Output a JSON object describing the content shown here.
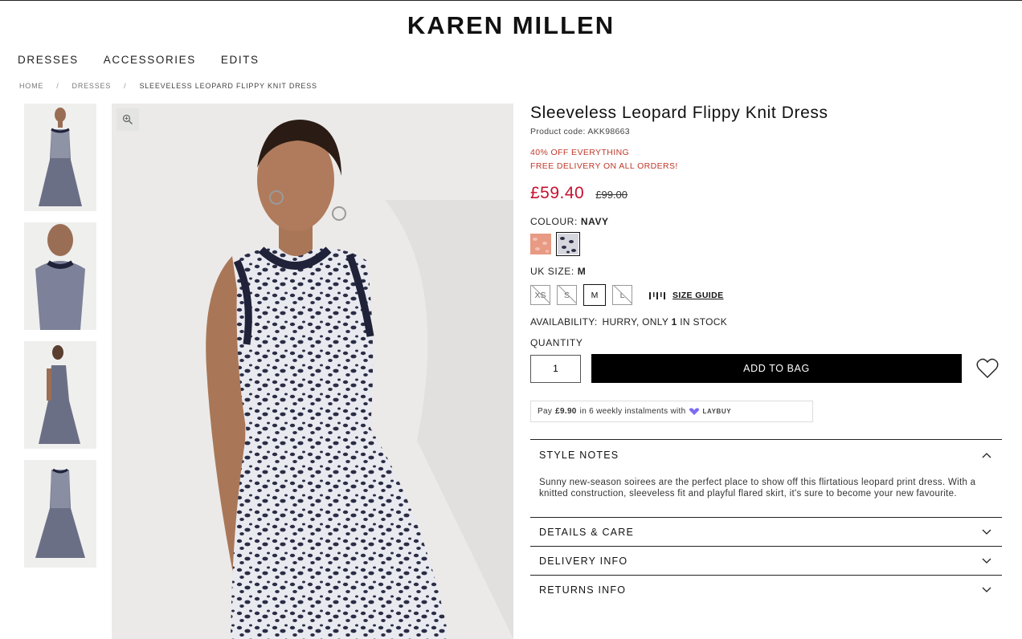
{
  "brand": {
    "name": "KAREN MILLEN"
  },
  "nav": {
    "items": [
      "DRESSES",
      "ACCESSORIES",
      "EDITS"
    ]
  },
  "breadcrumb": {
    "home": "HOME",
    "category": "DRESSES",
    "current": "SLEEVELESS LEOPARD FLIPPY KNIT DRESS",
    "separator": "/"
  },
  "product": {
    "title": "Sleeveless Leopard Flippy Knit Dress",
    "code": "Product code: AKK98663",
    "promo_1": "40% OFF EVERYTHING",
    "promo_2": "FREE DELIVERY ON ALL ORDERS!",
    "price_now": "£59.40",
    "price_was": "£99.00",
    "colour_label": "COLOUR:",
    "colour_value": "NAVY",
    "size_label": "UK SIZE:",
    "size_value": "M",
    "sizes": [
      "XS",
      "S",
      "M",
      "L"
    ],
    "size_guide": "SIZE GUIDE",
    "availability_label": "AVAILABILITY:",
    "availability_pre": "HURRY, ONLY",
    "availability_count": "1",
    "availability_post": "IN STOCK",
    "quantity_label": "QUANTITY",
    "quantity_value": "1",
    "add_to_bag": "ADD TO BAG",
    "colours": {
      "coral": "#e89a84",
      "navy": "#2c2f45"
    }
  },
  "laybuy": {
    "pay": "Pay",
    "amount": "£9.90",
    "rest": "in 6 weekly instalments with",
    "brand": "LAYBUY"
  },
  "accordion": {
    "style_notes": "STYLE NOTES",
    "style_notes_body": "Sunny new-season soirees are the perfect place to show off this flirtatious leopard print dress. With a knitted construction, sleeveless fit and playful flared skirt, it's sure to become your new favourite.",
    "details_care": "DETAILS & CARE",
    "delivery_info": "DELIVERY INFO",
    "returns_info": "RETURNS INFO"
  },
  "colors": {
    "accent_red": "#c8102e",
    "promo_red": "#c0392b",
    "black": "#000000"
  }
}
